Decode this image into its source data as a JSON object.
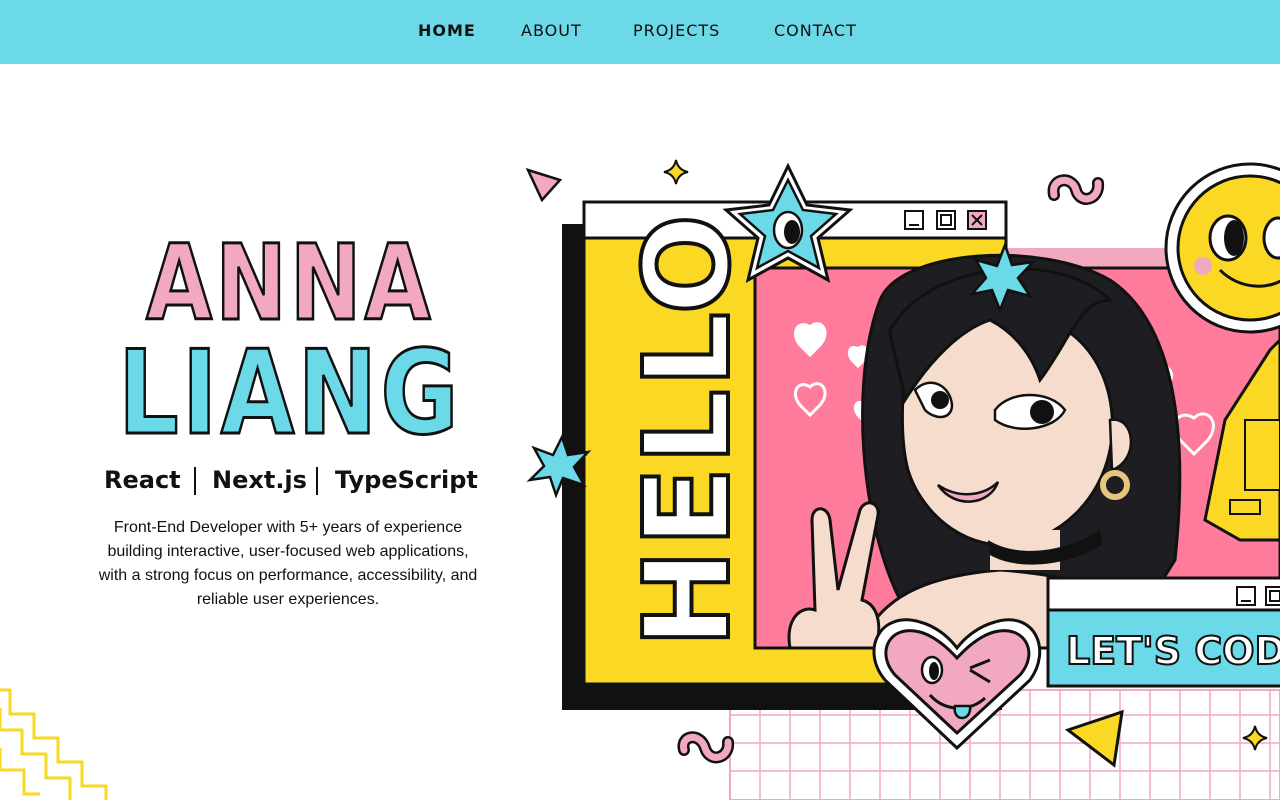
{
  "nav": {
    "items": [
      {
        "label": "HOME",
        "active": true
      },
      {
        "label": "ABOUT",
        "active": false
      },
      {
        "label": "PROJECTS",
        "active": false
      },
      {
        "label": "CONTACT",
        "active": false
      }
    ]
  },
  "hero": {
    "first_name": "ANNA",
    "last_name": "LIANG",
    "stack": [
      "React",
      "Next.js",
      "TypeScript"
    ],
    "bio": "Front-End Developer with 5+ years of experience building interactive, user-focused web applications, with a strong focus on performance, accessibility, and reliable user experiences."
  },
  "art": {
    "hello_text": "HELLO",
    "code_banner_text": "LET'S CODE"
  },
  "colors": {
    "nav_bg": "#6cd9e8",
    "pink": "#f2a9c0",
    "cyan": "#6cd9e8",
    "yellow": "#fad823",
    "hot_pink": "#ff7b9c",
    "ink": "#111111"
  },
  "icons": [
    "minimize-icon",
    "maximize-icon",
    "close-icon",
    "star-eye-icon",
    "smiley-icon",
    "heart-wink-icon",
    "sparkle-icon",
    "squiggle-icon",
    "triangle-icon",
    "retro-phone-icon"
  ]
}
